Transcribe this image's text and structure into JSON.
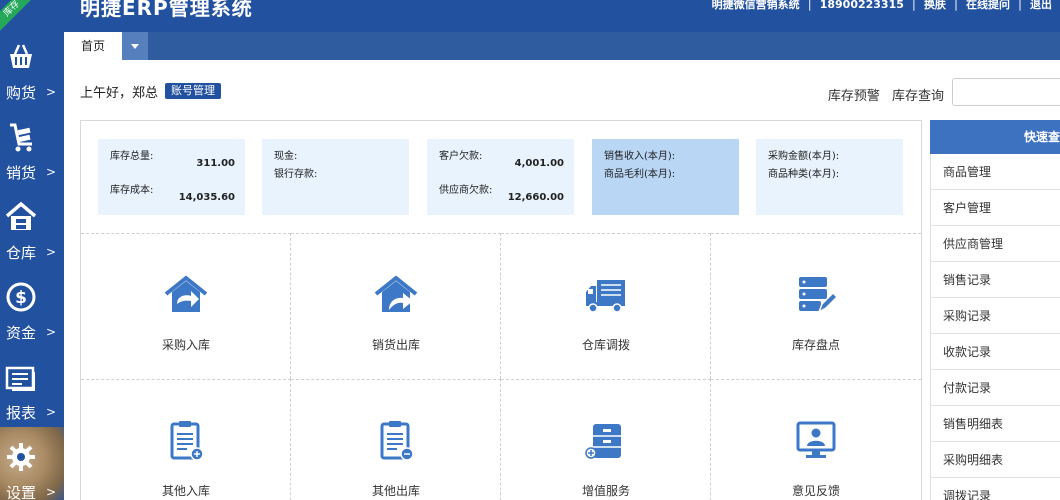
{
  "header": {
    "ribbon": "库存",
    "title": "明捷ERP管理系统",
    "links": [
      "明捷微信营销系统",
      "18900223315",
      "换肤",
      "在线提问",
      "退出"
    ]
  },
  "tabs": [
    {
      "label": "首页"
    }
  ],
  "sidebar": {
    "items": [
      {
        "label": "购货",
        "arrow": ">"
      },
      {
        "label": "销货",
        "arrow": ">"
      },
      {
        "label": "仓库",
        "arrow": ">"
      },
      {
        "label": "资金",
        "arrow": ">"
      },
      {
        "label": "报表",
        "arrow": ">"
      },
      {
        "label": "设置",
        "arrow": ">"
      }
    ]
  },
  "greeting": {
    "text": "上午好，郑总",
    "account_button": "账号管理"
  },
  "top_links": [
    "库存预警",
    "库存查询"
  ],
  "stats": [
    {
      "rows": [
        {
          "label": "库存总量:",
          "value": "311.00"
        },
        {
          "label": "库存成本:",
          "value": "14,035.60"
        }
      ]
    },
    {
      "rows": [
        {
          "label": "现金:",
          "value": ""
        },
        {
          "label": "银行存款:",
          "value": ""
        }
      ]
    },
    {
      "rows": [
        {
          "label": "客户欠款:",
          "value": "4,001.00"
        },
        {
          "label": "供应商欠款:",
          "value": "12,660.00"
        }
      ]
    },
    {
      "rows": [
        {
          "label": "销售收入(本月):",
          "value": ""
        },
        {
          "label": "商品毛利(本月):",
          "value": ""
        }
      ]
    },
    {
      "rows": [
        {
          "label": "采购金额(本月):",
          "value": ""
        },
        {
          "label": "商品种类(本月):",
          "value": ""
        }
      ]
    }
  ],
  "modules": [
    {
      "label": "采购入库",
      "icon": "house-arrow-in-icon"
    },
    {
      "label": "销货出库",
      "icon": "house-arrow-out-icon"
    },
    {
      "label": "仓库调拨",
      "icon": "truck-icon"
    },
    {
      "label": "库存盘点",
      "icon": "server-edit-icon"
    },
    {
      "label": "其他入库",
      "icon": "clipboard-in-icon"
    },
    {
      "label": "其他出库",
      "icon": "clipboard-out-icon"
    },
    {
      "label": "增值服务",
      "icon": "cabinet-plus-icon"
    },
    {
      "label": "意见反馈",
      "icon": "monitor-user-icon"
    }
  ],
  "quick": {
    "title": "快速查询",
    "items": [
      "商品管理",
      "客户管理",
      "供应商管理",
      "销售记录",
      "采购记录",
      "收款记录",
      "付款记录",
      "销售明细表",
      "采购明细表",
      "调拨记录"
    ]
  },
  "colors": {
    "brand": "#22519f",
    "tab_bar": "#2f5c9e",
    "icon_blue": "#3d78c7",
    "stat_bg": "#e8f3fd",
    "stat_active": "#b9d6f4"
  }
}
